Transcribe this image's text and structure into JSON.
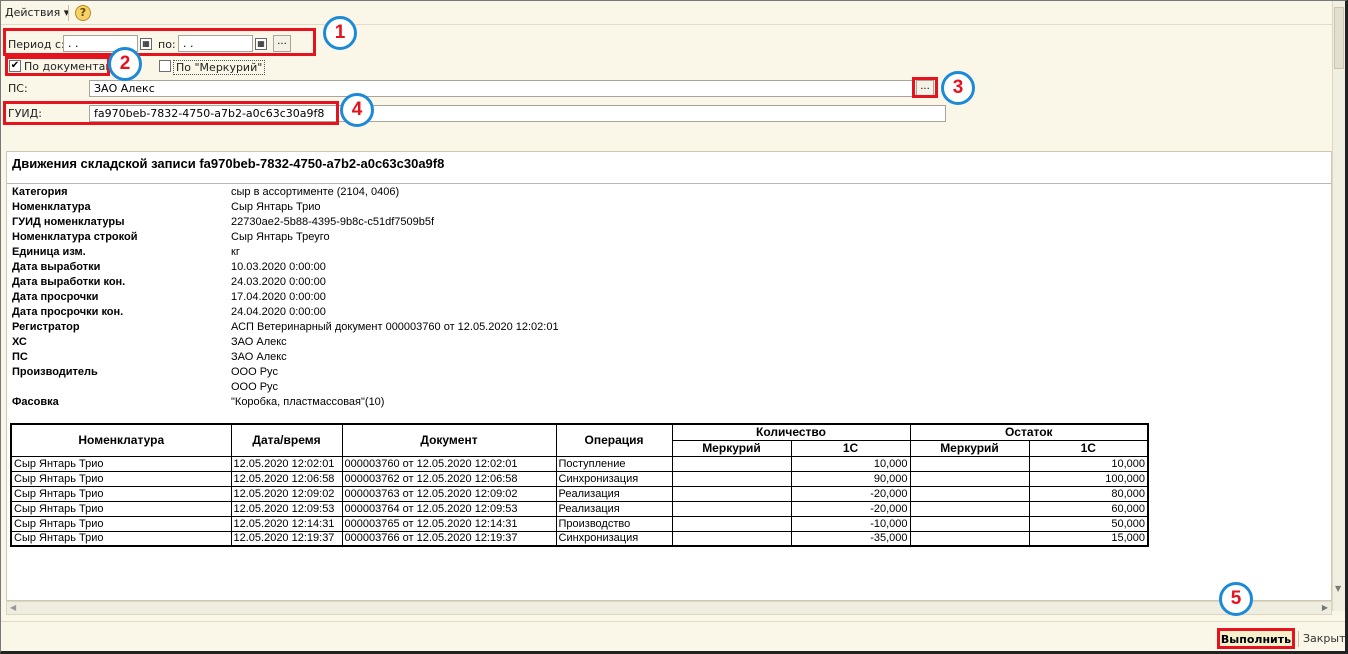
{
  "toolbar": {
    "actions_label": "Действия ▾",
    "help_label": "?"
  },
  "filters": {
    "period_from_label": "Период с:",
    "period_from_value": " .  .",
    "period_to_label": "по:",
    "period_to_value": " .  .",
    "period_button": "...",
    "by_documents_label": "По документам",
    "by_documents_checked": true,
    "by_mercury_label": "По \"Меркурий\"",
    "by_mercury_checked": false,
    "ps_label": "ПС:",
    "ps_value": "ЗАО  Алекс",
    "ps_button": "...",
    "guid_label": "ГУИД:",
    "guid_value": "fa970beb-7832-4750-a7b2-a0c63c30a9f8"
  },
  "markers": [
    "1",
    "2",
    "3",
    "4",
    "5"
  ],
  "report": {
    "title": "Движения складской записи fa970beb-7832-4750-a7b2-a0c63c30a9f8",
    "props": [
      {
        "k": "Категория",
        "v": "сыр в ассортименте (2104, 0406)"
      },
      {
        "k": "Номенклатура",
        "v": "Сыр Янтарь Трио"
      },
      {
        "k": "ГУИД номенклатуры",
        "v": "22730ae2-5b88-4395-9b8c-c51df7509b5f"
      },
      {
        "k": "Номенклатура строкой",
        "v": "Сыр Янтарь Треуго"
      },
      {
        "k": "Единица изм.",
        "v": "кг"
      },
      {
        "k": "Дата выработки",
        "v": "10.03.2020 0:00:00"
      },
      {
        "k": "Дата выработки кон.",
        "v": "24.03.2020 0:00:00"
      },
      {
        "k": "Дата просрочки",
        "v": "17.04.2020 0:00:00"
      },
      {
        "k": "Дата просрочки кон.",
        "v": "24.04.2020 0:00:00"
      },
      {
        "k": "Регистратор",
        "v": "АСП Ветеринарный документ 000003760 от 12.05.2020 12:02:01"
      },
      {
        "k": "ХС",
        "v": "ЗАО  Алекс"
      },
      {
        "k": "ПС",
        "v": "ЗАО  Алекс"
      },
      {
        "k": "Производитель",
        "v": "ООО Рус"
      },
      {
        "k": "",
        "v": "ООО Рус"
      },
      {
        "k": "Фасовка",
        "v": "\"Коробка, пластмассовая\"(10)"
      }
    ],
    "table": {
      "headers": {
        "nomenclature": "Номенклатура",
        "datetime": "Дата/время",
        "document": "Документ",
        "operation": "Операция",
        "quantity": "Количество",
        "balance": "Остаток",
        "mercury": "Меркурий",
        "onec": "1С"
      },
      "rows": [
        {
          "n": "Сыр Янтарь Трио",
          "d": "12.05.2020 12:02:01",
          "doc": "000003760 от 12.05.2020 12:02:01",
          "op": "Поступление",
          "qm": "",
          "q1": "10,000",
          "bm": "",
          "b1": "10,000"
        },
        {
          "n": "Сыр Янтарь Трио",
          "d": "12.05.2020 12:06:58",
          "doc": "000003762 от 12.05.2020 12:06:58",
          "op": "Синхронизация",
          "qm": "",
          "q1": "90,000",
          "bm": "",
          "b1": "100,000"
        },
        {
          "n": "Сыр Янтарь Трио",
          "d": "12.05.2020 12:09:02",
          "doc": "000003763 от 12.05.2020 12:09:02",
          "op": "Реализация",
          "qm": "",
          "q1": "-20,000",
          "bm": "",
          "b1": "80,000"
        },
        {
          "n": "Сыр Янтарь Трио",
          "d": "12.05.2020 12:09:53",
          "doc": "000003764 от 12.05.2020 12:09:53",
          "op": "Реализация",
          "qm": "",
          "q1": "-20,000",
          "bm": "",
          "b1": "60,000"
        },
        {
          "n": "Сыр Янтарь Трио",
          "d": "12.05.2020 12:14:31",
          "doc": "000003765 от 12.05.2020 12:14:31",
          "op": "Производство",
          "qm": "",
          "q1": "-10,000",
          "bm": "",
          "b1": "50,000"
        },
        {
          "n": "Сыр Янтарь Трио",
          "d": "12.05.2020 12:19:37",
          "doc": "000003766 от 12.05.2020 12:19:37",
          "op": "Синхронизация",
          "qm": "",
          "q1": "-35,000",
          "bm": "",
          "b1": "15,000"
        }
      ]
    }
  },
  "footer": {
    "run_label": "Выполнить",
    "close_label": "Закрыть"
  },
  "colors": {
    "highlight": "#e5131d",
    "marker_ring": "#1c8ad6",
    "panel": "#faf6e8"
  }
}
